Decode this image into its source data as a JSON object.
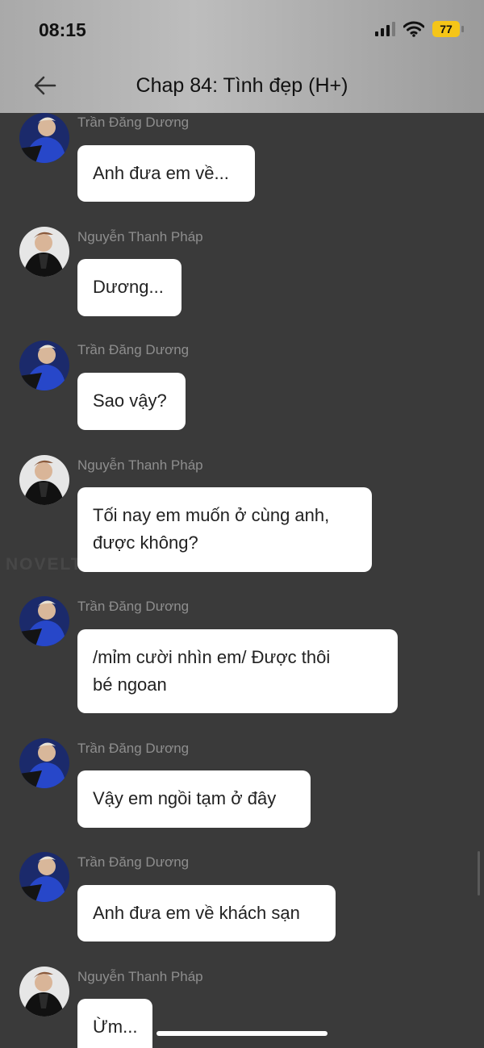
{
  "status_bar": {
    "time": "08:15",
    "battery": "77"
  },
  "header": {
    "title": "Chap 84: Tình đẹp (H+)"
  },
  "watermark": "NOVELTOON",
  "messages": [
    {
      "sender": "Trần Đăng Dương",
      "text": "Anh đưa em về...",
      "avatar": "duong"
    },
    {
      "sender": "Nguyễn Thanh Pháp",
      "text": "Dương...",
      "avatar": "phap"
    },
    {
      "sender": "Trần Đăng Dương",
      "text": "Sao vậy?",
      "avatar": "duong"
    },
    {
      "sender": "Nguyễn Thanh Pháp",
      "text": "Tối nay em muốn ở cùng anh, được không?",
      "line1": "Tối nay em muốn ở cùng anh,",
      "line2": "được không?",
      "avatar": "phap"
    },
    {
      "sender": "Trần Đăng Dương",
      "text": "/mỉm cười nhìn em/ Được thôi bé ngoan",
      "line1": "/mỉm cười nhìn em/ Được thôi",
      "line2": "bé ngoan",
      "avatar": "duong"
    },
    {
      "sender": "Trần Đăng Dương",
      "text": "Vậy em ngồi tạm ở đây",
      "avatar": "duong"
    },
    {
      "sender": "Trần Đăng Dương",
      "text": "Anh đưa em về khách sạn",
      "avatar": "duong"
    },
    {
      "sender": "Nguyễn Thanh Pháp",
      "text": "Ừm...",
      "avatar": "phap"
    }
  ],
  "colors": {
    "background": "#3a3a3a",
    "bubble": "#ffffff",
    "sender": "#8e8e8e",
    "battery": "#f5c518"
  }
}
